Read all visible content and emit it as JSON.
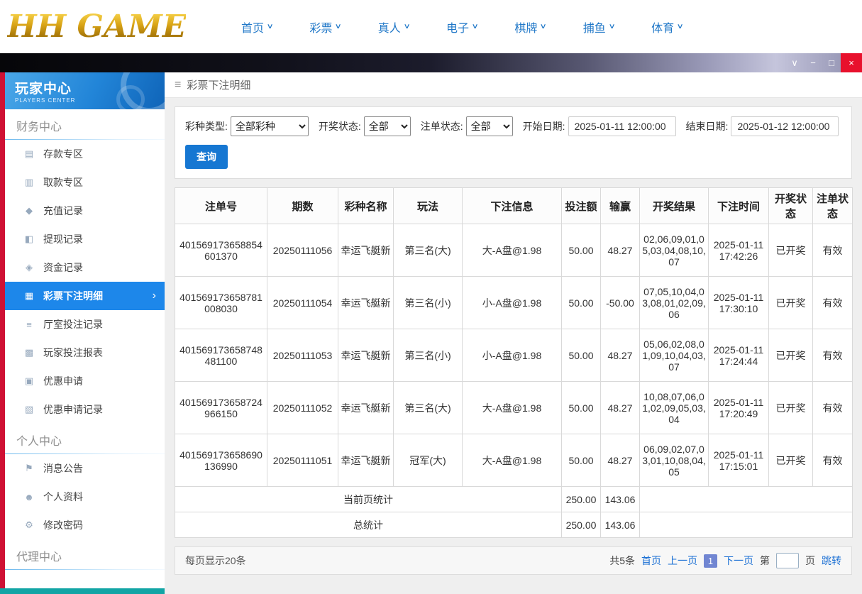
{
  "brand": {
    "logo_text": "HH GAME"
  },
  "topnav": {
    "items": [
      "首页",
      "彩票",
      "真人",
      "电子",
      "棋牌",
      "捕鱼",
      "体育"
    ]
  },
  "window_controls": {
    "collapse": "∨",
    "minimize": "−",
    "maximize": "□",
    "close": "×"
  },
  "sidebar": {
    "title": "玩家中心",
    "subtitle": "PLAYERS CENTER",
    "sections": [
      {
        "label": "财务中心",
        "items": [
          {
            "label": "存款专区",
            "icon": "deposit-icon",
            "glyph": "▤"
          },
          {
            "label": "取款专区",
            "icon": "withdraw-icon",
            "glyph": "▥"
          },
          {
            "label": "充值记录",
            "icon": "recharge-record-icon",
            "glyph": "◆"
          },
          {
            "label": "提现记录",
            "icon": "withdrawal-record-icon",
            "glyph": "◧"
          },
          {
            "label": "资金记录",
            "icon": "funds-record-icon",
            "glyph": "◈"
          },
          {
            "label": "彩票下注明细",
            "icon": "lottery-bet-detail-icon",
            "glyph": "▦",
            "active": true
          },
          {
            "label": "厅室投注记录",
            "icon": "hall-bet-record-icon",
            "glyph": "≡"
          },
          {
            "label": "玩家投注报表",
            "icon": "player-bet-report-icon",
            "glyph": "▩"
          },
          {
            "label": "优惠申请",
            "icon": "promo-apply-icon",
            "glyph": "▣"
          },
          {
            "label": "优惠申请记录",
            "icon": "promo-apply-record-icon",
            "glyph": "▧"
          }
        ]
      },
      {
        "label": "个人中心",
        "items": [
          {
            "label": "消息公告",
            "icon": "bell-icon",
            "glyph": "⚑"
          },
          {
            "label": "个人资料",
            "icon": "profile-icon",
            "glyph": "☻"
          },
          {
            "label": "修改密码",
            "icon": "gear-icon",
            "glyph": "⚙"
          }
        ]
      },
      {
        "label": "代理中心",
        "items": []
      }
    ]
  },
  "breadcrumb": {
    "menu_icon": "≡",
    "title": "彩票下注明细"
  },
  "filters": {
    "lottery_type_label": "彩种类型:",
    "lottery_type_value": "全部彩种",
    "draw_status_label": "开奖状态:",
    "draw_status_value": "全部",
    "order_status_label": "注单状态:",
    "order_status_value": "全部",
    "start_date_label": "开始日期:",
    "start_date_value": "2025-01-11 12:00:00",
    "end_date_label": "结束日期:",
    "end_date_value": "2025-01-12 12:00:00",
    "query_button": "查询"
  },
  "table": {
    "headers": [
      "注单号",
      "期数",
      "彩种名称",
      "玩法",
      "下注信息",
      "投注额",
      "输赢",
      "开奖结果",
      "下注时间",
      "开奖状态",
      "注单状态"
    ],
    "rows": [
      {
        "order_id": "401569173658854601370",
        "period": "20250111056",
        "game": "幸运飞艇新",
        "play": "第三名(大)",
        "bet_info": "大-A盘@1.98",
        "amount": "50.00",
        "winloss": "48.27",
        "result": "02,06,09,01,05,03,04,08,10,07",
        "time": "2025-01-11 17:42:26",
        "draw_status": "已开奖",
        "order_status": "有效"
      },
      {
        "order_id": "401569173658781008030",
        "period": "20250111054",
        "game": "幸运飞艇新",
        "play": "第三名(小)",
        "bet_info": "小-A盘@1.98",
        "amount": "50.00",
        "winloss": "-50.00",
        "result": "07,05,10,04,03,08,01,02,09,06",
        "time": "2025-01-11 17:30:10",
        "draw_status": "已开奖",
        "order_status": "有效"
      },
      {
        "order_id": "401569173658748481100",
        "period": "20250111053",
        "game": "幸运飞艇新",
        "play": "第三名(小)",
        "bet_info": "小-A盘@1.98",
        "amount": "50.00",
        "winloss": "48.27",
        "result": "05,06,02,08,01,09,10,04,03,07",
        "time": "2025-01-11 17:24:44",
        "draw_status": "已开奖",
        "order_status": "有效"
      },
      {
        "order_id": "401569173658724966150",
        "period": "20250111052",
        "game": "幸运飞艇新",
        "play": "第三名(大)",
        "bet_info": "大-A盘@1.98",
        "amount": "50.00",
        "winloss": "48.27",
        "result": "10,08,07,06,01,02,09,05,03,04",
        "time": "2025-01-11 17:20:49",
        "draw_status": "已开奖",
        "order_status": "有效"
      },
      {
        "order_id": "401569173658690136990",
        "period": "20250111051",
        "game": "幸运飞艇新",
        "play": "冠军(大)",
        "bet_info": "大-A盘@1.98",
        "amount": "50.00",
        "winloss": "48.27",
        "result": "06,09,02,07,03,01,10,08,04,05",
        "time": "2025-01-11 17:15:01",
        "draw_status": "已开奖",
        "order_status": "有效"
      }
    ],
    "page_summary": {
      "label": "当前页统计",
      "bet_total": "250.00",
      "winloss_total": "143.06"
    },
    "total_summary": {
      "label": "总统计",
      "bet_total": "250.00",
      "winloss_total": "143.06"
    }
  },
  "pagination": {
    "page_size_text": "每页显示20条",
    "total_text": "共5条",
    "first": "首页",
    "prev": "上一页",
    "current_page": "1",
    "next": "下一页",
    "jump_prefix": "第",
    "jump_suffix": "页",
    "jump_button": "跳转"
  }
}
